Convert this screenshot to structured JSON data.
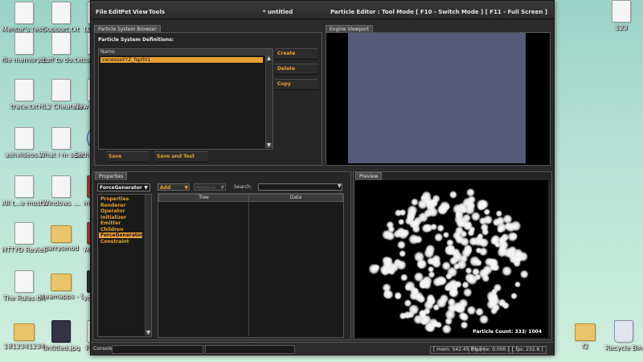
{
  "desktop": {
    "icons": [
      {
        "label": "Mentor's test words.txt",
        "kind": "doc"
      },
      {
        "label": "Support.txt",
        "kind": "doc"
      },
      {
        "label": "LOLOLO",
        "kind": "doc"
      },
      {
        "label": "file memory train.txt",
        "kind": "doc"
      },
      {
        "label": "stuff to do.txt",
        "kind": "doc"
      },
      {
        "label": "concrete",
        "kind": "doc"
      },
      {
        "label": "trace.txt",
        "kind": "doc"
      },
      {
        "label": "HL2 Cheats.txt",
        "kind": "doc"
      },
      {
        "label": "New T Docume",
        "kind": "doc"
      },
      {
        "label": "ashvideos...",
        "kind": "doc"
      },
      {
        "label": "What i m saving mon...",
        "kind": "doc"
      },
      {
        "label": "Sothink Decomp",
        "kind": "orb"
      },
      {
        "label": "All t...e most HORRIFIC...",
        "kind": "doc"
      },
      {
        "label": "Windows_...",
        "kind": "doc"
      },
      {
        "label": "minecra",
        "kind": "zip"
      },
      {
        "label": "HTTYD Review.txt",
        "kind": "doc"
      },
      {
        "label": "garrysmod",
        "kind": "folder"
      },
      {
        "label": "MINECR",
        "kind": "zip"
      },
      {
        "label": "The Rules.txt",
        "kind": "doc"
      },
      {
        "label": "steamapps - Shortcut",
        "kind": "folder"
      },
      {
        "label": "youtube",
        "kind": "img"
      },
      {
        "label": "1812341234",
        "kind": "folder"
      },
      {
        "label": "Untitled.jpg",
        "kind": "img"
      },
      {
        "label": "Portals",
        "kind": "doc"
      },
      {
        "label": "123",
        "kind": "doc"
      },
      {
        "label": "f2",
        "kind": "folder"
      },
      {
        "label": "Recycle Bin",
        "kind": "trash"
      }
    ]
  },
  "window": {
    "menus": [
      "File",
      "Edit",
      "Pet",
      "View",
      "Tools"
    ],
    "title_center": "* untitled",
    "title_right": "Particle Editor : Tool Mode [ F10 - Switch Mode ] [ F11 - Full Screen ]"
  },
  "browser": {
    "tab": "Particle System Browser",
    "heading": "Particle System Definitions:",
    "column": "Name",
    "items": [
      "vanessaXYZ_fsp001"
    ],
    "buttons": {
      "create": "Create",
      "delete": "Delete",
      "copy": "Copy",
      "save": "Save",
      "save_and_test": "Save and Test"
    }
  },
  "viewport": {
    "tab": "Engine Viewport"
  },
  "properties": {
    "tab": "Properties",
    "dropdown_value": "ForceGenerator",
    "categories": [
      "Properties",
      "Renderer",
      "Operator",
      "Initializer",
      "Emitter",
      "Children",
      "ForceGenerator",
      "Constraint"
    ],
    "selected_category": "ForceGenerator",
    "add_label": "Add",
    "remove_label": "Remove",
    "search_label": "Search:",
    "search_value": "",
    "columns": [
      "Tree",
      "Data"
    ]
  },
  "preview": {
    "tab": "Preview",
    "particle_count": "Particle Count:  333/ 1004"
  },
  "status": {
    "console": "Console",
    "mem": "[ mem: 542.45 Mb ]",
    "game": "[ game: 0.000 ]",
    "fps": "[ fps: 232.6 ]"
  },
  "colors": {
    "accent": "#e8a030",
    "selection": "#f2a33a",
    "viewport_fill": "#575a78",
    "panel_bg": "#1e1e1e"
  }
}
